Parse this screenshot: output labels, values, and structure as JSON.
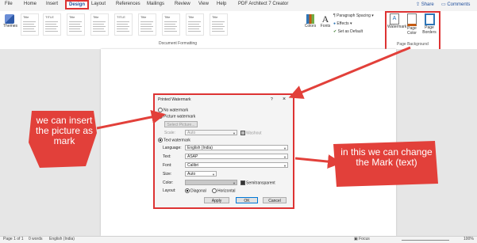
{
  "tabs": [
    {
      "label": "File"
    },
    {
      "label": "Home"
    },
    {
      "label": "Insert"
    },
    {
      "label": "Design"
    },
    {
      "label": "Layout"
    },
    {
      "label": "References"
    },
    {
      "label": "Mailings"
    },
    {
      "label": "Review"
    },
    {
      "label": "View"
    },
    {
      "label": "Help"
    },
    {
      "label": "PDF Architect 7 Creator"
    }
  ],
  "ribbon": {
    "share": "Share",
    "comments": "Comments",
    "themes": "Themes",
    "style_titles": [
      "Title",
      "TITLE",
      "Title",
      "Title",
      "TITLE",
      "Title",
      "Title",
      "Title",
      "Title"
    ],
    "doc_formatting": "Document Formatting",
    "colors": "Colors",
    "fonts": "Fonts",
    "paragraph_spacing": "Paragraph Spacing",
    "effects": "Effects",
    "set_default": "Set as Default",
    "watermark": "Watermark",
    "page_color": "Page Color",
    "page_borders": "Page Borders",
    "page_background": "Page Background"
  },
  "dialog": {
    "title": "Printed Watermark",
    "help": "?",
    "close": "×",
    "no_watermark": "No watermark",
    "picture_watermark": "Picture watermark",
    "select_picture": "Select Picture...",
    "scale_label": "Scale:",
    "scale_value": "Auto",
    "washout": "Washout",
    "text_watermark": "Text watermark",
    "language_label": "Language:",
    "language_value": "English (India)",
    "text_label": "Text:",
    "text_value": "ASAP",
    "font_label": "Font:",
    "font_value": "Calibri",
    "size_label": "Size:",
    "size_value": "Auto",
    "color_label": "Color:",
    "semitransparent": "Semitransparent",
    "layout_label": "Layout:",
    "diagonal": "Diagonal",
    "horizontal": "Horizontal",
    "apply": "Apply",
    "ok": "OK",
    "cancel": "Cancel"
  },
  "annotations": {
    "left": "we can insert the picture as mark",
    "right": "in this we can change the Mark (text)",
    "accent": "#e2403a"
  },
  "status": {
    "page": "Page 1 of 1",
    "words": "0 words",
    "language": "English (India)",
    "focus": "Focus",
    "zoom": "100%"
  }
}
